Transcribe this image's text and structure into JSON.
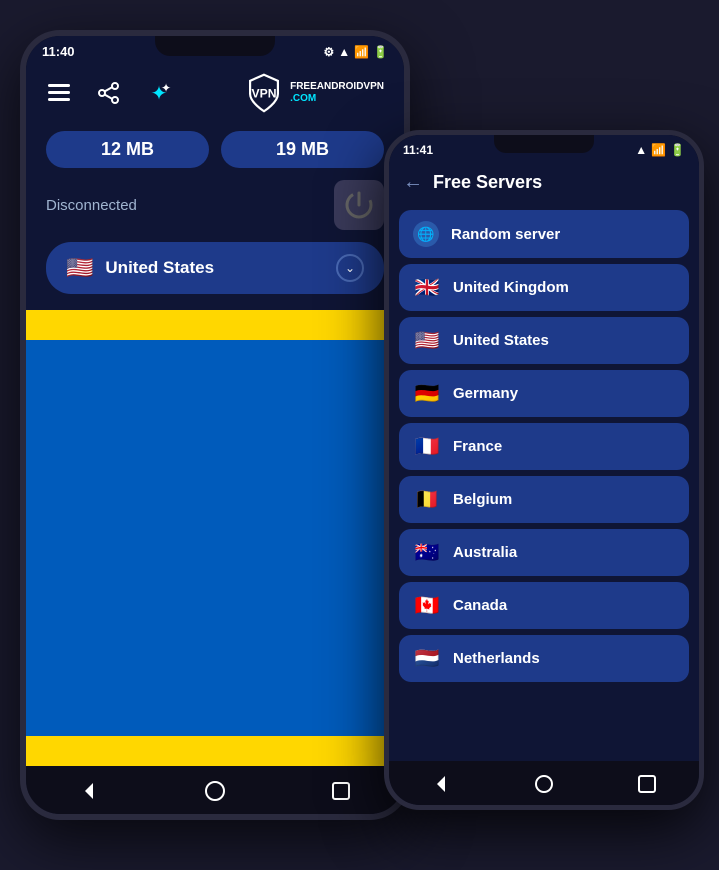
{
  "phone1": {
    "statusBar": {
      "time": "11:40",
      "icons": "⚙ ▲"
    },
    "stats": {
      "download": "12 MB",
      "upload": "19 MB"
    },
    "status": "Disconnected",
    "country": "United States",
    "countryFlag": "🇺🇸"
  },
  "phone2": {
    "statusBar": {
      "time": "11:41",
      "icons": "▲"
    },
    "header": "Free Servers",
    "servers": [
      {
        "name": "Random server",
        "flag": "🌐",
        "isGlobe": true
      },
      {
        "name": "United Kingdom",
        "flag": "🇬🇧"
      },
      {
        "name": "United States",
        "flag": "🇺🇸"
      },
      {
        "name": "Germany",
        "flag": "🇩🇪"
      },
      {
        "name": "France",
        "flag": "🇫🇷"
      },
      {
        "name": "Belgium",
        "flag": "🇧🇪"
      },
      {
        "name": "Australia",
        "flag": "🇦🇺"
      },
      {
        "name": "Canada",
        "flag": "🇨🇦"
      },
      {
        "name": "Netherlands",
        "flag": "🇳🇱"
      }
    ]
  }
}
